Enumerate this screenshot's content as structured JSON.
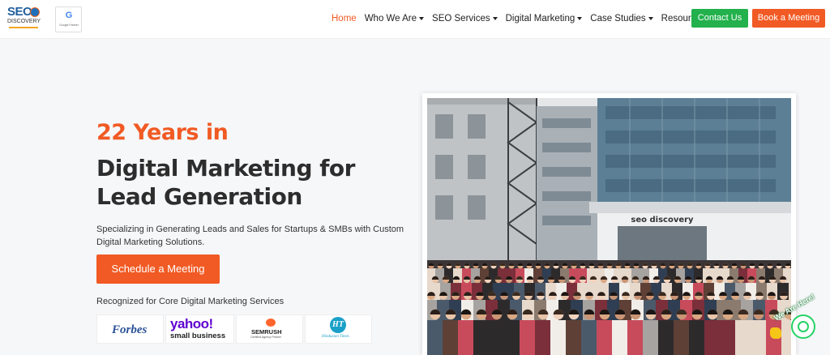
{
  "header": {
    "logo_text": "SEO",
    "logo_sub": "DISCOVERY",
    "partner_badge": "Google Partner",
    "nav": [
      {
        "label": "Home",
        "active": true,
        "has_dropdown": false
      },
      {
        "label": "Who We Are",
        "active": false,
        "has_dropdown": true
      },
      {
        "label": "SEO Services",
        "active": false,
        "has_dropdown": true
      },
      {
        "label": "Digital Marketing",
        "active": false,
        "has_dropdown": true
      },
      {
        "label": "Case Studies",
        "active": false,
        "has_dropdown": true
      },
      {
        "label": "Resources",
        "active": false,
        "has_dropdown": true
      }
    ],
    "contact_label": "Contact Us",
    "book_label": "Book a Meeting"
  },
  "hero": {
    "kicker": "22 Years in",
    "title_line1": "Digital Marketing for",
    "title_line2": "Lead Generation",
    "subtitle": "Specializing in Generating Leads and Sales for Startups & SMBs with Custom Digital Marketing Solutions.",
    "cta_label": "Schedule a Meeting",
    "recognized_label": "Recognized for Core Digital Marketing Services",
    "press": {
      "forbes": "Forbes",
      "yahoo": "yahoo!",
      "yahoo_sub": "small business",
      "semrush": "SEMRUSH",
      "semrush_sub": "Certified Agency Partner",
      "ht_mark": "HT",
      "ht_name": "Hindustan Times"
    }
  },
  "photo": {
    "sign_text": "seo discovery"
  },
  "whatsapp": {
    "label": "We Are Here!"
  },
  "colors": {
    "accent": "#f15a24",
    "contact_green": "#22b14c",
    "whatsapp": "#25d366"
  }
}
